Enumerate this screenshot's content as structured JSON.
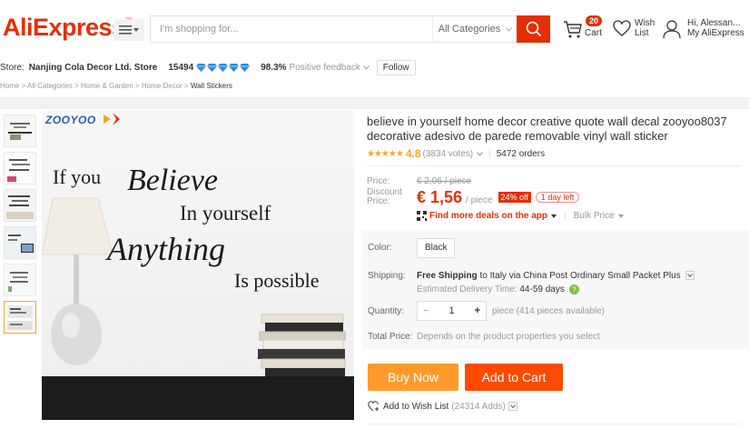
{
  "header": {
    "logo": "AliExpress",
    "logo_tm": "™",
    "search_placeholder": "I'm shopping for...",
    "category_select": "All Categories",
    "cart_count": "20",
    "cart_label": "Cart",
    "wish_line1": "Wish",
    "wish_line2": "List",
    "account_line1": "Hi, Alessan...",
    "account_line2": "My AliExpress"
  },
  "store": {
    "label": "Store:",
    "name": "Nanjing Cola Decor Ltd. Store",
    "score": "15494",
    "feedback_pct": "98.3%",
    "feedback_label": "Positive feedback",
    "follow_label": "Follow"
  },
  "breadcrumb": {
    "items": [
      "Home",
      "All Categories",
      "Home & Garden",
      "Home Decor"
    ],
    "current": "Wall Stickers",
    "separator": " > "
  },
  "image": {
    "brand": "ZOOYOO",
    "quote_line1": "If you",
    "quote_line2": "Believe",
    "quote_line3": "In yourself",
    "quote_line4": "Anything",
    "quote_line5": "Is possible"
  },
  "product": {
    "title": "believe in yourself home decor creative quote wall decal zooyoo8037 decorative adesivo de parede removable vinyl wall sticker",
    "stars": "★★★★★",
    "rating": "4.8",
    "votes": "(3834 votes)",
    "orders": "5472 orders"
  },
  "price": {
    "price_label": "Price:",
    "original": "€ 2,06 / piece",
    "discount_label_line1": "Discount",
    "discount_label_line2": "Price:",
    "discount_value": "€ 1,56",
    "unit": "/ piece",
    "off_badge": "24% off",
    "time_badge": "1 day left",
    "app_deals": "Find more deals on the app",
    "bulk_price": "Bulk Price"
  },
  "sku": {
    "color_label": "Color:",
    "color_value": "Black",
    "shipping_label": "Shipping:",
    "shipping_bold": "Free Shipping",
    "shipping_rest": "to Italy via China Post Ordinary Small Packet Plus",
    "delivery_label": "Estimated Delivery Time:",
    "delivery_value": "44-59 days",
    "quantity_label": "Quantity:",
    "quantity_minus": "−",
    "quantity_value": "1",
    "quantity_plus": "+",
    "quantity_note": "piece (414 pieces available)",
    "total_label": "Total Price:",
    "total_note": "Depends on the product properties you select"
  },
  "actions": {
    "buy_now": "Buy Now",
    "add_to_cart": "Add to Cart",
    "wishlist": "Add to Wish List",
    "wishlist_adds": "(24314 Adds)"
  },
  "colors": {
    "brand_red": "#e62e04",
    "buy_orange": "#ff9a2a",
    "cart_orange": "#ff4a00",
    "star": "#f5a623"
  }
}
